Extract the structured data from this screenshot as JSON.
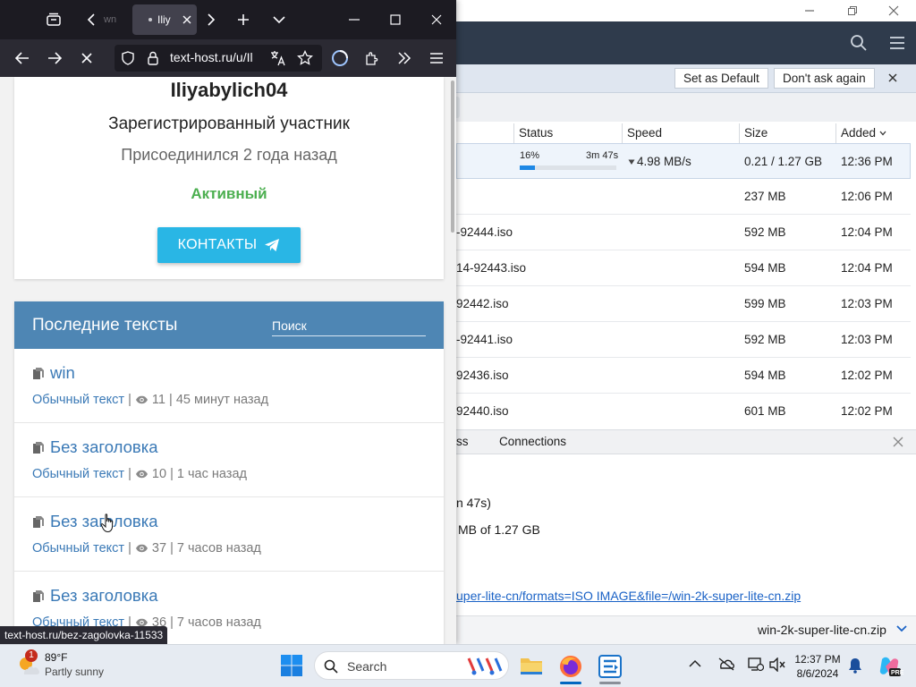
{
  "dm": {
    "banner": {
      "set_default": "Set as Default",
      "dont_ask": "Don't ask again"
    },
    "columns": {
      "status": "Status",
      "speed": "Speed",
      "size": "Size",
      "added": "Added"
    },
    "active": {
      "percent": "16%",
      "progress": 0.16,
      "eta": "3m 47s",
      "speed": "4.98 MB/s",
      "size": "0.21 / 1.27 GB",
      "added": "12:36 PM"
    },
    "rows": [
      {
        "name": "",
        "size": "237 MB",
        "added": "12:06 PM"
      },
      {
        "name": "-92444.iso",
        "size": "592 MB",
        "added": "12:04 PM"
      },
      {
        "name": "14-92443.iso",
        "size": "594 MB",
        "added": "12:04 PM"
      },
      {
        "name": "92442.iso",
        "size": "599 MB",
        "added": "12:03 PM"
      },
      {
        "name": "-92441.iso",
        "size": "592 MB",
        "added": "12:03 PM"
      },
      {
        "name": "92436.iso",
        "size": "594 MB",
        "added": "12:02 PM"
      },
      {
        "name": "92440.iso",
        "size": "601 MB",
        "added": "12:02 PM"
      }
    ],
    "details_tabs": {
      "tab_partial": "ss",
      "tab_connections": "Connections"
    },
    "details": {
      "eta_fragment": "n 47s)",
      "progress_fragment": "MB of 1.27 GB",
      "link_fragment": "uper-lite-cn/formats=ISO IMAGE&file=/win-2k-super-lite-cn.zip"
    },
    "footer_file": "win-2k-super-lite-cn.zip"
  },
  "browser": {
    "tab_prev_label": "wn",
    "tab_active_label": "Iliy",
    "url": "text-host.ru/u/Il",
    "status_url": "text-host.ru/bez-zagolovka-11533"
  },
  "profile": {
    "username": "Iliyabylich04",
    "role": "Зарегистрированный участник",
    "joined": "Присоединился 2 года назад",
    "status": "Активный",
    "contacts_button": "КОНТАКТЫ"
  },
  "texts": {
    "heading": "Последние тексты",
    "search_placeholder": "Поиск",
    "items": [
      {
        "title": "win",
        "type": "Обычный текст",
        "views": "11",
        "ago": "45 минут назад"
      },
      {
        "title": "Без заголовка",
        "type": "Обычный текст",
        "views": "10",
        "ago": "1 час назад"
      },
      {
        "title": "Без заголовка",
        "type": "Обычный текст",
        "views": "37",
        "ago": "7 часов назад"
      },
      {
        "title": "Без заголовка",
        "type": "Обычный текст",
        "views": "36",
        "ago": "7 часов назад"
      }
    ]
  },
  "taskbar": {
    "weather_temp": "89°F",
    "weather_desc": "Partly sunny",
    "weather_badge": "1",
    "search_label": "Search",
    "time": "12:37 PM",
    "date": "8/6/2024"
  },
  "colors": {
    "accent_blue": "#29b6e5",
    "panel_header": "#4e86b4",
    "active_green": "#4caf50",
    "link_blue": "#3a79b6",
    "progress_blue": "#1e88e5"
  }
}
